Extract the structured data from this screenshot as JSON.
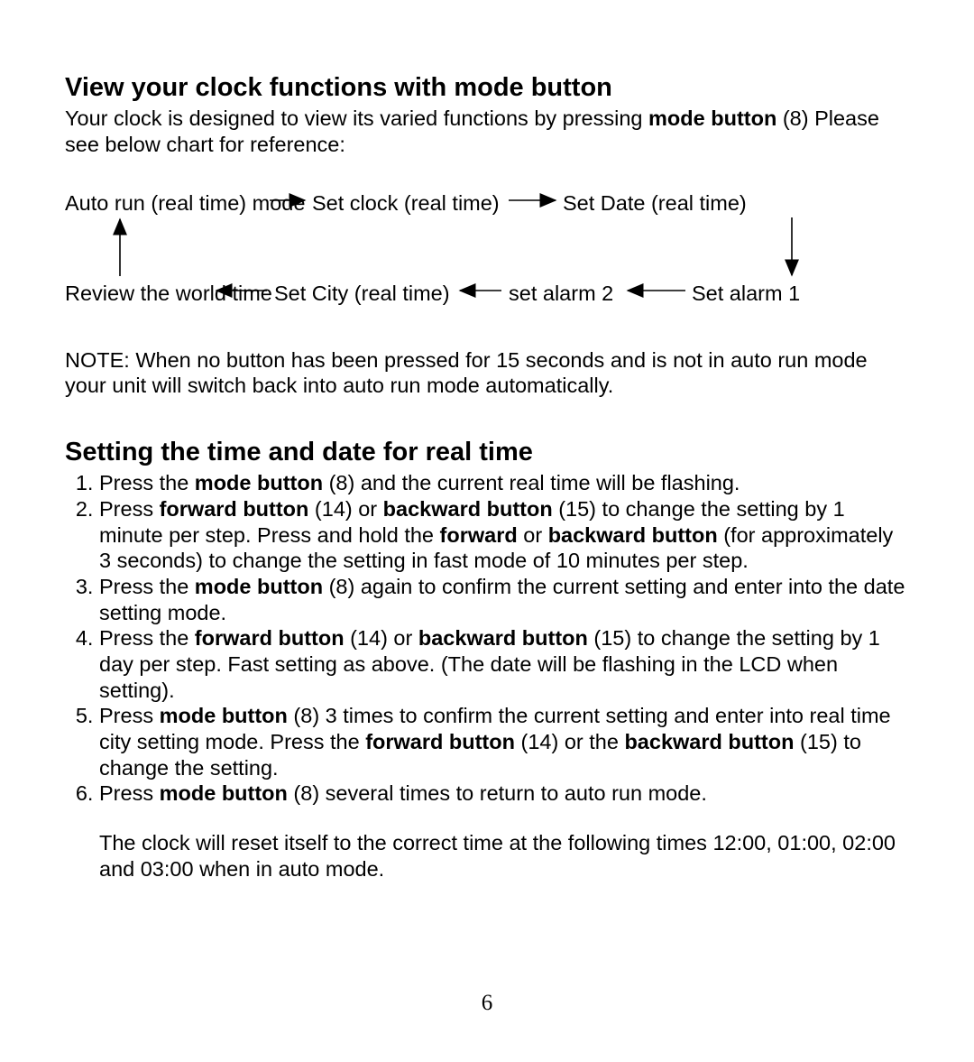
{
  "section1": {
    "heading": "View your clock functions with mode button",
    "intro_before_bold": "Your clock is designed to view its varied functions by pressing ",
    "intro_bold": "mode button",
    "intro_after_bold": " (8) Please see below chart for reference:"
  },
  "diagram": {
    "auto_run": "Auto run (real time) mode",
    "set_clock": "Set clock (real time)",
    "set_date": "Set Date (real time)",
    "review_world": "Review the world time",
    "set_city": "Set City (real time)",
    "set_alarm2": "set alarm 2",
    "set_alarm1": "Set alarm 1"
  },
  "note": "NOTE:  When no button has been pressed for 15 seconds and is not in auto run mode your unit will switch back into auto run mode automatically.",
  "section2": {
    "heading": "Setting the time and date for real time",
    "steps": [
      {
        "parts": [
          {
            "t": "Press the "
          },
          {
            "b": "mode button"
          },
          {
            "t": " (8) and the current real time will be flashing."
          }
        ]
      },
      {
        "parts": [
          {
            "t": "Press "
          },
          {
            "b": "forward button"
          },
          {
            "t": " (14) or "
          },
          {
            "b": "backward button"
          },
          {
            "t": " (15) to change the setting by 1 minute per step. Press and hold the "
          },
          {
            "b": "forward"
          },
          {
            "t": " or "
          },
          {
            "b": "backward button"
          },
          {
            "t": " (for approximately 3 seconds) to change the setting in fast mode of 10 minutes per step."
          }
        ]
      },
      {
        "parts": [
          {
            "t": "Press the "
          },
          {
            "b": "mode button"
          },
          {
            "t": " (8) again to confirm the current setting and enter into the date setting mode."
          }
        ]
      },
      {
        "parts": [
          {
            "t": "Press the "
          },
          {
            "b": "forward button"
          },
          {
            "t": " (14) or "
          },
          {
            "b": "backward button"
          },
          {
            "t": " (15) to change the setting by 1 day per step.  Fast setting as above.  (The date will be flashing in the LCD when setting)."
          }
        ]
      },
      {
        "parts": [
          {
            "t": "Press "
          },
          {
            "b": "mode button"
          },
          {
            "t": " (8) 3 times to confirm the current setting and enter into real time city setting mode.  Press the "
          },
          {
            "b": "forward button"
          },
          {
            "t": " (14) or the "
          },
          {
            "b": "backward button"
          },
          {
            "t": " (15) to change the setting."
          }
        ]
      },
      {
        "parts": [
          {
            "t": "Press "
          },
          {
            "b": "mode button"
          },
          {
            "t": " (8) several times to return to auto run mode."
          }
        ]
      }
    ],
    "closing": "The clock will reset itself to the correct time at the following times 12:00, 01:00, 02:00 and 03:00 when in auto mode."
  },
  "page_number": "6"
}
